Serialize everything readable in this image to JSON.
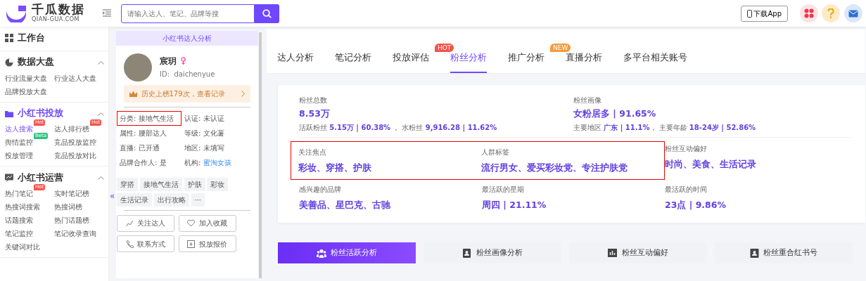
{
  "header": {
    "logo_title": "千瓜数据",
    "logo_subtitle": "QIAN-GUA.COM",
    "search": {
      "placeholder": "请输入达人、笔记、品牌等搜"
    },
    "download": "下载App"
  },
  "sidebar": [
    {
      "title": "工作台",
      "collapsible": false
    },
    {
      "title": "数据大盘",
      "collapsible": true,
      "items": [
        {
          "label": "行业流量大盘",
          "selected": false
        },
        {
          "label": "行业达人大盘",
          "selected": false
        },
        {
          "label": "品牌投放大盘",
          "selected": false
        }
      ]
    },
    {
      "title": "小红书投放",
      "collapsible": true,
      "items": [
        {
          "label": "达人搜索",
          "selected": true,
          "badge": {
            "text": "Hot",
            "kind": "hot"
          }
        },
        {
          "label": "达人排行榜",
          "selected": false,
          "badge": {
            "text": "Hot",
            "kind": "hot"
          }
        },
        {
          "label": "舆情监控",
          "selected": false,
          "badge": {
            "text": "Beta",
            "kind": "beta"
          }
        },
        {
          "label": "竞品投放监控",
          "selected": false
        },
        {
          "label": "投放管理",
          "selected": false
        },
        {
          "label": "竞品投放对比",
          "selected": false
        }
      ]
    },
    {
      "title": "小红书运营",
      "collapsible": true,
      "items": [
        {
          "label": "热门笔记",
          "selected": false,
          "badge": {
            "text": "Hot",
            "kind": "hot"
          }
        },
        {
          "label": "实时笔记榜",
          "selected": false
        },
        {
          "label": "热搜词搜索",
          "selected": false
        },
        {
          "label": "热搜词榜",
          "selected": false
        },
        {
          "label": "话题搜索",
          "selected": false
        },
        {
          "label": "热门话题榜",
          "selected": false
        },
        {
          "label": "笔记监控",
          "selected": false
        },
        {
          "label": "笔记收录查询",
          "selected": false
        },
        {
          "label": "关键词对比",
          "selected": false
        }
      ]
    }
  ],
  "collapse_toggle": "«",
  "profile": {
    "title": "小红书达人分析",
    "name": "宸玥",
    "id": "ID:  daichenyue",
    "history": "历史上榜179次，查看记录",
    "fields": [
      {
        "label": "分类:",
        "value": "接地气生活",
        "highlighted": true,
        "kind": "text"
      },
      {
        "label": "认证:",
        "value": "未认证",
        "highlighted": false,
        "kind": "text"
      },
      {
        "label": "属性:",
        "value": "腰部达人",
        "highlighted": false,
        "kind": "text"
      },
      {
        "label": "等级:",
        "value": "文化薯",
        "highlighted": false,
        "kind": "text"
      },
      {
        "label": "直播:",
        "value": "已开通",
        "highlighted": false,
        "kind": "text"
      },
      {
        "label": "地区:",
        "value": "未填写",
        "highlighted": false,
        "kind": "text"
      },
      {
        "label": "品牌合作人:",
        "value": "是",
        "highlighted": false,
        "kind": "text"
      },
      {
        "label": "机构:",
        "value": "蜜淘女孩",
        "highlighted": false,
        "kind": "link"
      }
    ],
    "tags": [
      "穿搭",
      "接地气生活",
      "护肤",
      "彩妆",
      "生活记录",
      "出行攻略",
      "···"
    ],
    "actions": [
      "关注达人",
      "加入收藏",
      "联系方式",
      "投放报价"
    ]
  },
  "tabs": [
    {
      "label": "达人分析",
      "selected": false
    },
    {
      "label": "笔记分析",
      "selected": false
    },
    {
      "label": "投放评估",
      "selected": false
    },
    {
      "label": "粉丝分析",
      "selected": true,
      "badge": {
        "text": "HOT",
        "kind": "hot"
      }
    },
    {
      "label": "推广分析",
      "selected": false
    },
    {
      "label": "直播分析",
      "selected": false,
      "badge": {
        "text": "NEW",
        "kind": "new"
      }
    },
    {
      "label": "多平台相关账号",
      "selected": false
    }
  ],
  "stats": {
    "top": [
      {
        "label": "粉丝总数",
        "value": "8.53万",
        "detail": "活跃粉丝 **5.15万 | 60.38%** ， 水粉丝 **9,916.28 | 11.62%**"
      },
      {
        "label": "粉丝画像",
        "value": "女粉居多 | 91.65%",
        "detail": "主要地区 **广东 | 11.1%**， 主要年龄 **18-24岁 | 52.86%**"
      }
    ],
    "grid": [
      [
        {
          "label": "关注焦点",
          "value": "彩妆、穿搭、护肤",
          "highlighted": true
        },
        {
          "label": "人群标签",
          "value": "流行男女、爱买彩妆党、专注护肤党",
          "highlighted": true
        },
        {
          "label": "粉丝互动偏好",
          "value": "时尚、美食、生活记录",
          "highlighted": false
        }
      ],
      [
        {
          "label": "感兴趣的品牌",
          "value": "美善品、星巴克、古驰",
          "highlighted": false
        },
        {
          "label": "最活跃的星期",
          "value": "周四 | 21.11%",
          "highlighted": false
        },
        {
          "label": "最活跃的时间",
          "value": "23点 | 9.86%",
          "highlighted": false
        }
      ]
    ]
  },
  "sections": [
    {
      "label": "粉丝活跃分析",
      "selected": true
    },
    {
      "label": "粉丝画像分析",
      "selected": false
    },
    {
      "label": "粉丝互动偏好",
      "selected": false
    },
    {
      "label": "粉丝重合红书号",
      "selected": false
    }
  ]
}
